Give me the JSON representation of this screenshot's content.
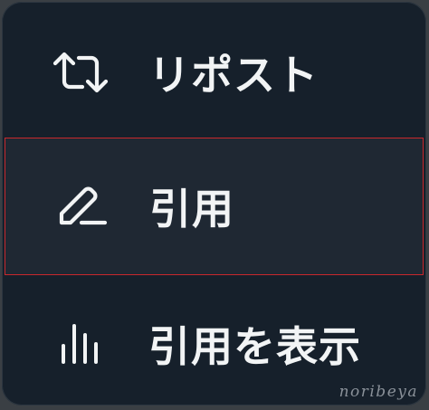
{
  "menu": {
    "items": [
      {
        "icon": "repost-icon",
        "label": "リポスト"
      },
      {
        "icon": "edit-pencil-icon",
        "label": "引用"
      },
      {
        "icon": "bar-chart-icon",
        "label": "引用を表示"
      }
    ]
  },
  "watermark": "noribeya",
  "colors": {
    "menu_background": "#16202b",
    "highlight_background": "#1f2833",
    "highlight_border": "#c8282d",
    "text": "#f2f4f5"
  }
}
